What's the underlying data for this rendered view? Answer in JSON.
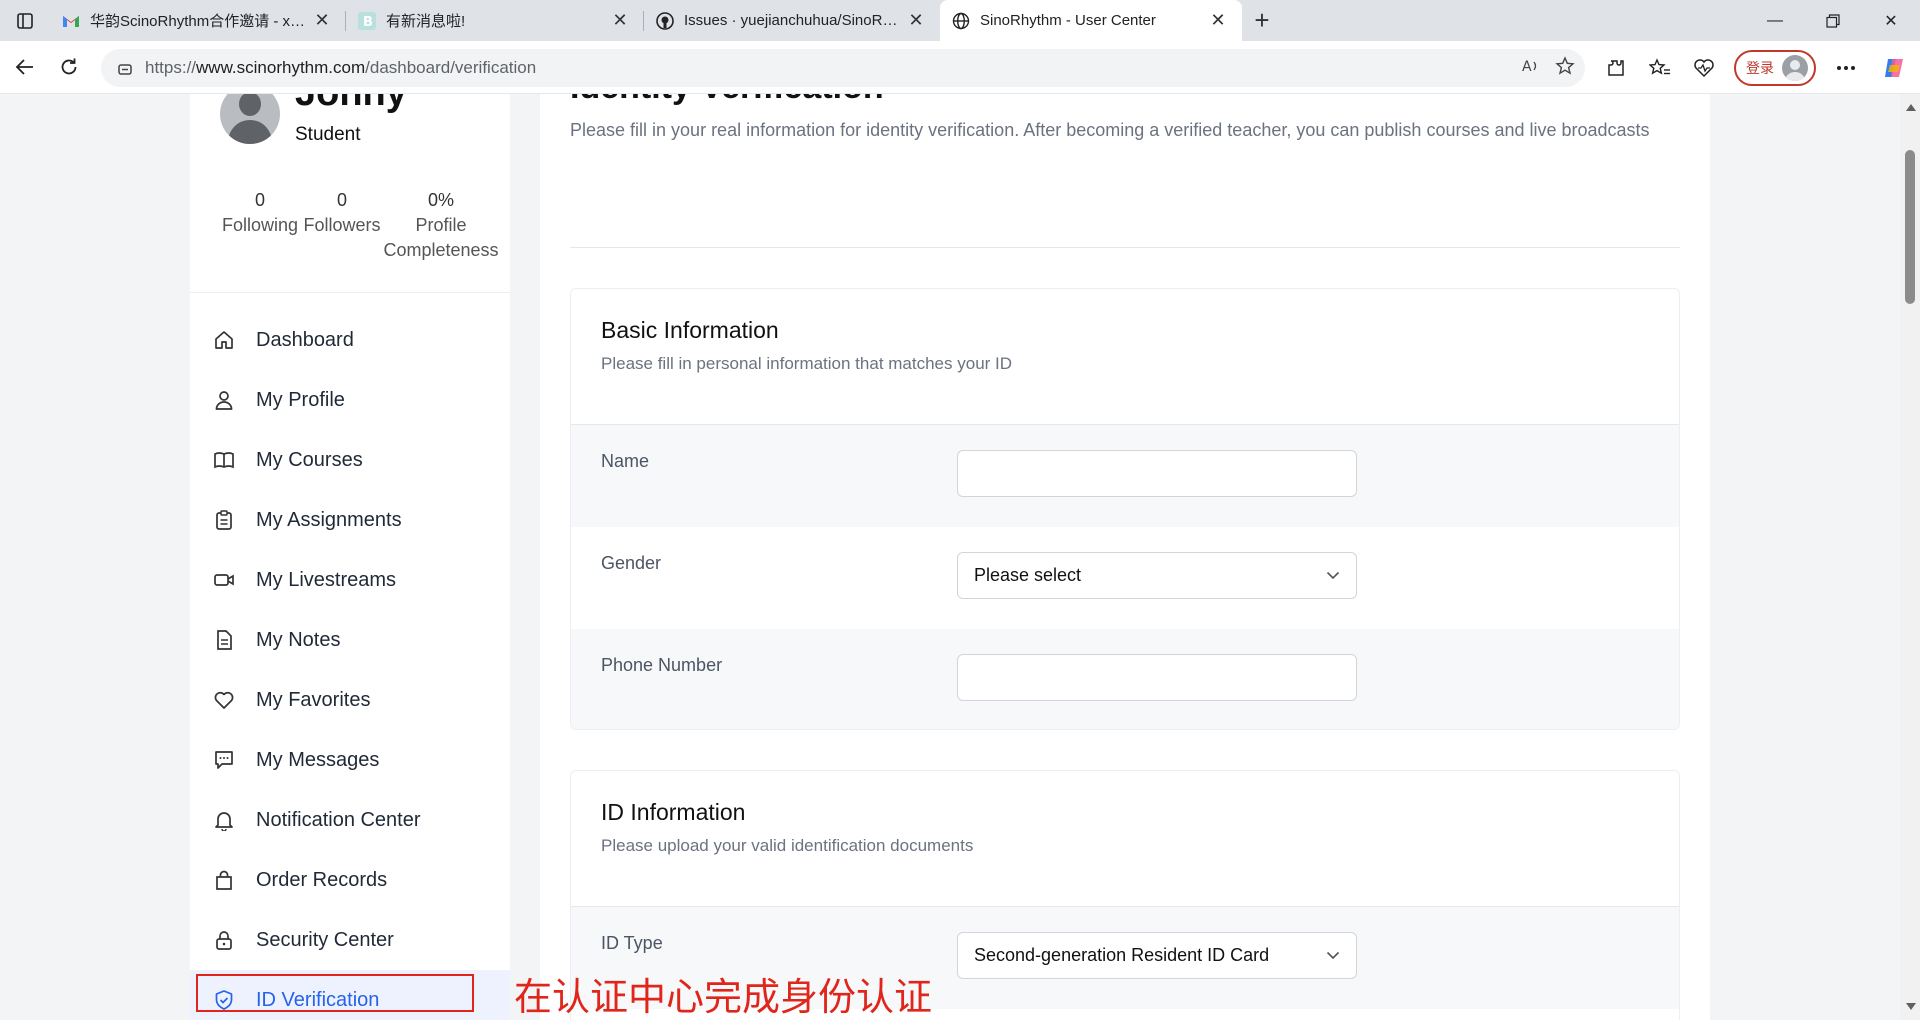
{
  "browser": {
    "tabs": [
      {
        "title": "华韵ScinoRhythm合作邀请 - xuan",
        "icon": "gmail-icon",
        "active": false
      },
      {
        "title": "有新消息啦!",
        "icon": "b-site-icon",
        "active": false
      },
      {
        "title": "Issues · yuejianchuhua/SinoRhyth",
        "icon": "github-icon",
        "active": false
      },
      {
        "title": "SinoRhythm - User Center",
        "icon": "globe-icon",
        "active": true
      }
    ],
    "url_prefix": "https://",
    "url_host": "www.scinorhythm.com",
    "url_path": "/dashboard/verification",
    "login_label": "登录"
  },
  "sidebar": {
    "user_name": "Johny",
    "user_role": "Student",
    "stats": [
      {
        "value": "0",
        "label": "Following"
      },
      {
        "value": "0",
        "label": "Followers"
      },
      {
        "value": "0%",
        "label": "Profile Completeness"
      }
    ],
    "items": [
      {
        "label": "Dashboard",
        "icon": "home-icon"
      },
      {
        "label": "My Profile",
        "icon": "user-icon"
      },
      {
        "label": "My Courses",
        "icon": "book-icon"
      },
      {
        "label": "My Assignments",
        "icon": "clipboard-icon"
      },
      {
        "label": "My Livestreams",
        "icon": "video-icon"
      },
      {
        "label": "My Notes",
        "icon": "note-icon"
      },
      {
        "label": "My Favorites",
        "icon": "heart-icon"
      },
      {
        "label": "My Messages",
        "icon": "message-icon"
      },
      {
        "label": "Notification Center",
        "icon": "bell-icon"
      },
      {
        "label": "Order Records",
        "icon": "bag-icon"
      },
      {
        "label": "Security Center",
        "icon": "lock-icon"
      },
      {
        "label": "ID Verification",
        "icon": "shield-icon",
        "active": true
      }
    ]
  },
  "annotation": "在认证中心完成身份认证",
  "main": {
    "title": "Identity Verification",
    "description": "Please fill in your real information for identity verification. After becoming a verified teacher, you can publish courses and live broadcasts",
    "basic": {
      "title": "Basic Information",
      "subtitle": "Please fill in personal information that matches your ID",
      "name_label": "Name",
      "name_value": "",
      "gender_label": "Gender",
      "gender_value": "Please select",
      "phone_label": "Phone Number",
      "phone_value": ""
    },
    "id_info": {
      "title": "ID Information",
      "subtitle": "Please upload your valid identification documents",
      "id_type_label": "ID Type",
      "id_type_value": "Second-generation Resident ID Card"
    }
  },
  "colors": {
    "accent": "#2563eb",
    "annotation": "#e0261b"
  }
}
